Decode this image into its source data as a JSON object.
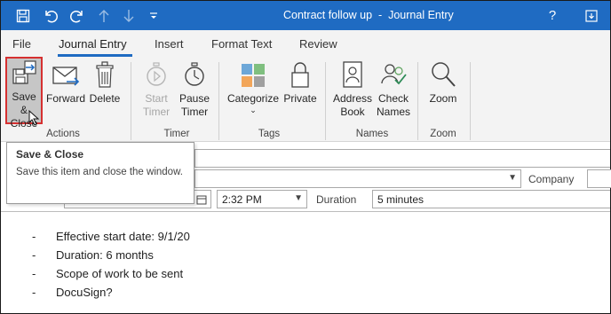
{
  "window": {
    "title": "Contract follow up  -  Journal Entry",
    "help_label": "?",
    "accent": "#1f6bc2"
  },
  "quick_access": [
    {
      "name": "save-icon",
      "glyph": "💾"
    },
    {
      "name": "undo-icon",
      "glyph": "↶"
    },
    {
      "name": "redo-icon",
      "glyph": "↻"
    },
    {
      "name": "up-arrow-icon",
      "glyph": "↑"
    },
    {
      "name": "down-arrow-icon",
      "glyph": "↓"
    },
    {
      "name": "customize-icon",
      "glyph": "≑"
    }
  ],
  "tabs": [
    "File",
    "Journal Entry",
    "Insert",
    "Format Text",
    "Review"
  ],
  "ribbon": {
    "actions": {
      "label": "Actions",
      "save_close": [
        "Save &",
        "Close"
      ],
      "forward": "Forward",
      "delete": "Delete"
    },
    "timer": {
      "label": "Timer",
      "start": [
        "Start",
        "Timer"
      ],
      "pause": [
        "Pause",
        "Timer"
      ]
    },
    "tags": {
      "label": "Tags",
      "categorize": "Categorize",
      "private": "Private"
    },
    "names": {
      "label": "Names",
      "address_book": [
        "Address",
        "Book"
      ],
      "check_names": [
        "Check",
        "Names"
      ]
    },
    "zoom": {
      "label": "Zoom",
      "zoom": "Zoom"
    }
  },
  "tooltip": {
    "title": "Save & Close",
    "body": "Save this item and close the window."
  },
  "form": {
    "company_label": "Company",
    "time_value": "2:32 PM",
    "duration_label": "Duration",
    "duration_value": "5 minutes"
  },
  "notes": [
    "Effective start date: 9/1/20",
    "Duration: 6 months",
    "Scope of work to be sent",
    "DocuSign?"
  ],
  "bullet_char": "-"
}
